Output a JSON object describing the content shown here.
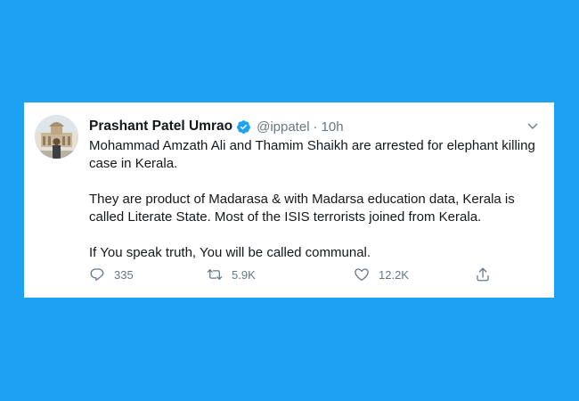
{
  "tweet": {
    "author_name": "Prashant Patel Umrao",
    "handle": "@ippatel",
    "separator": "·",
    "time": "10h",
    "paragraphs": [
      "Mohammad Amzath Ali and Thamim Shaikh are arrested for elephant killing case in Kerala.",
      "They are product of Madarasa & with Madarsa education data, Kerala is called Literate State. Most of the ISIS terrorists joined from Kerala.",
      "If You speak truth, You will be called communal."
    ],
    "counts": {
      "replies": "335",
      "retweets": "5.9K",
      "likes": "12.2K"
    }
  },
  "colors": {
    "background": "#1da1f2",
    "card": "#ffffff",
    "text_primary": "#14171a",
    "text_secondary": "#657786",
    "verified": "#1da1f2"
  },
  "icons": {
    "verified": "verified-badge-icon",
    "menu": "chevron-down-icon",
    "reply": "reply-icon",
    "retweet": "retweet-icon",
    "like": "heart-icon",
    "share": "share-icon"
  }
}
